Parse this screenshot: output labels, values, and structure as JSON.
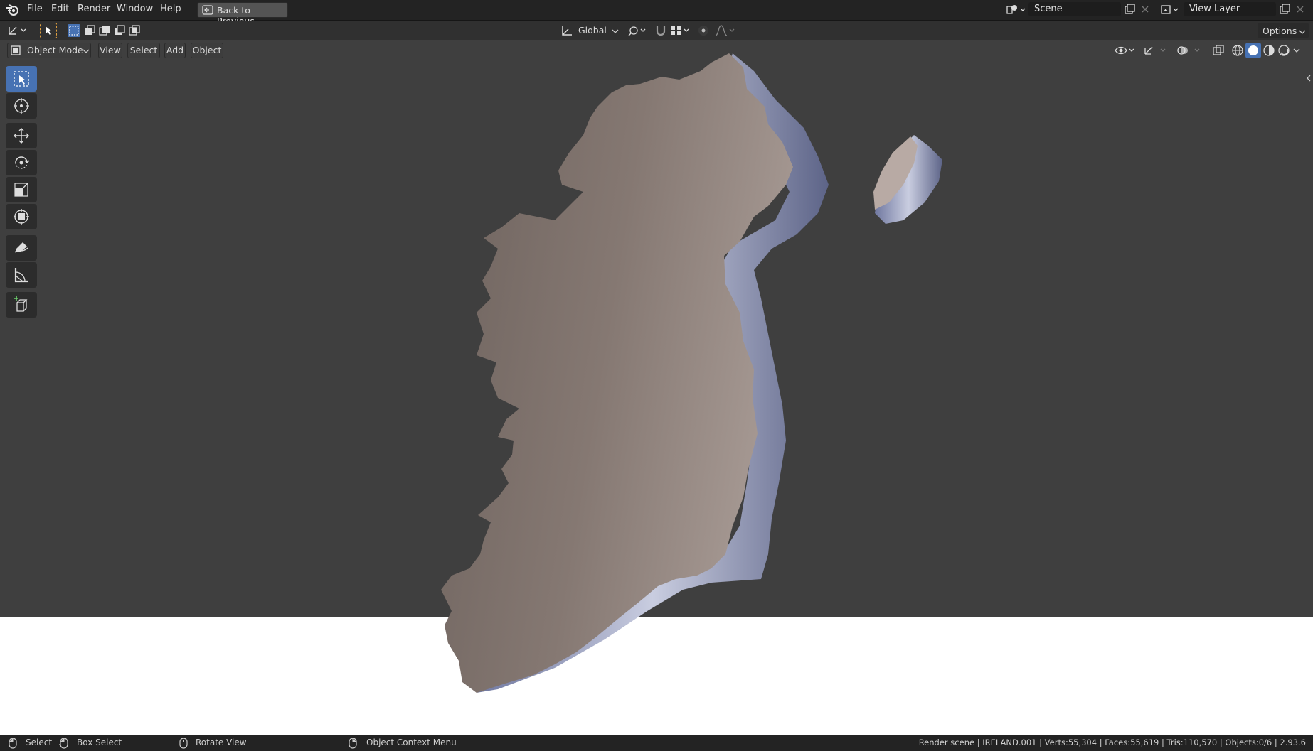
{
  "topbar": {
    "menus": [
      "File",
      "Edit",
      "Render",
      "Window",
      "Help"
    ],
    "back_button": "Back to Previous",
    "scene": "Scene",
    "view_layer": "View Layer"
  },
  "tool_header": {
    "orientation": "Global",
    "options": "Options"
  },
  "viewport_header": {
    "mode": "Object Mode",
    "menus": [
      "View",
      "Select",
      "Add",
      "Object"
    ]
  },
  "toolbar_tools": [
    "select-box",
    "cursor",
    "move",
    "rotate",
    "scale",
    "transform",
    "annotate",
    "measure",
    "add-cube"
  ],
  "statusbar": {
    "select": "Select",
    "box_select": "Box Select",
    "rotate_view": "Rotate View",
    "context_menu": "Object Context Menu",
    "stats": "Render scene | IRELAND.001 | Verts:55,304 | Faces:55,619 | Tris:110,570 | Objects:0/6 | 2.93.6"
  },
  "colors": {
    "accent": "#4772b3",
    "header": "#232323",
    "viewport": "#3f3f3f"
  }
}
